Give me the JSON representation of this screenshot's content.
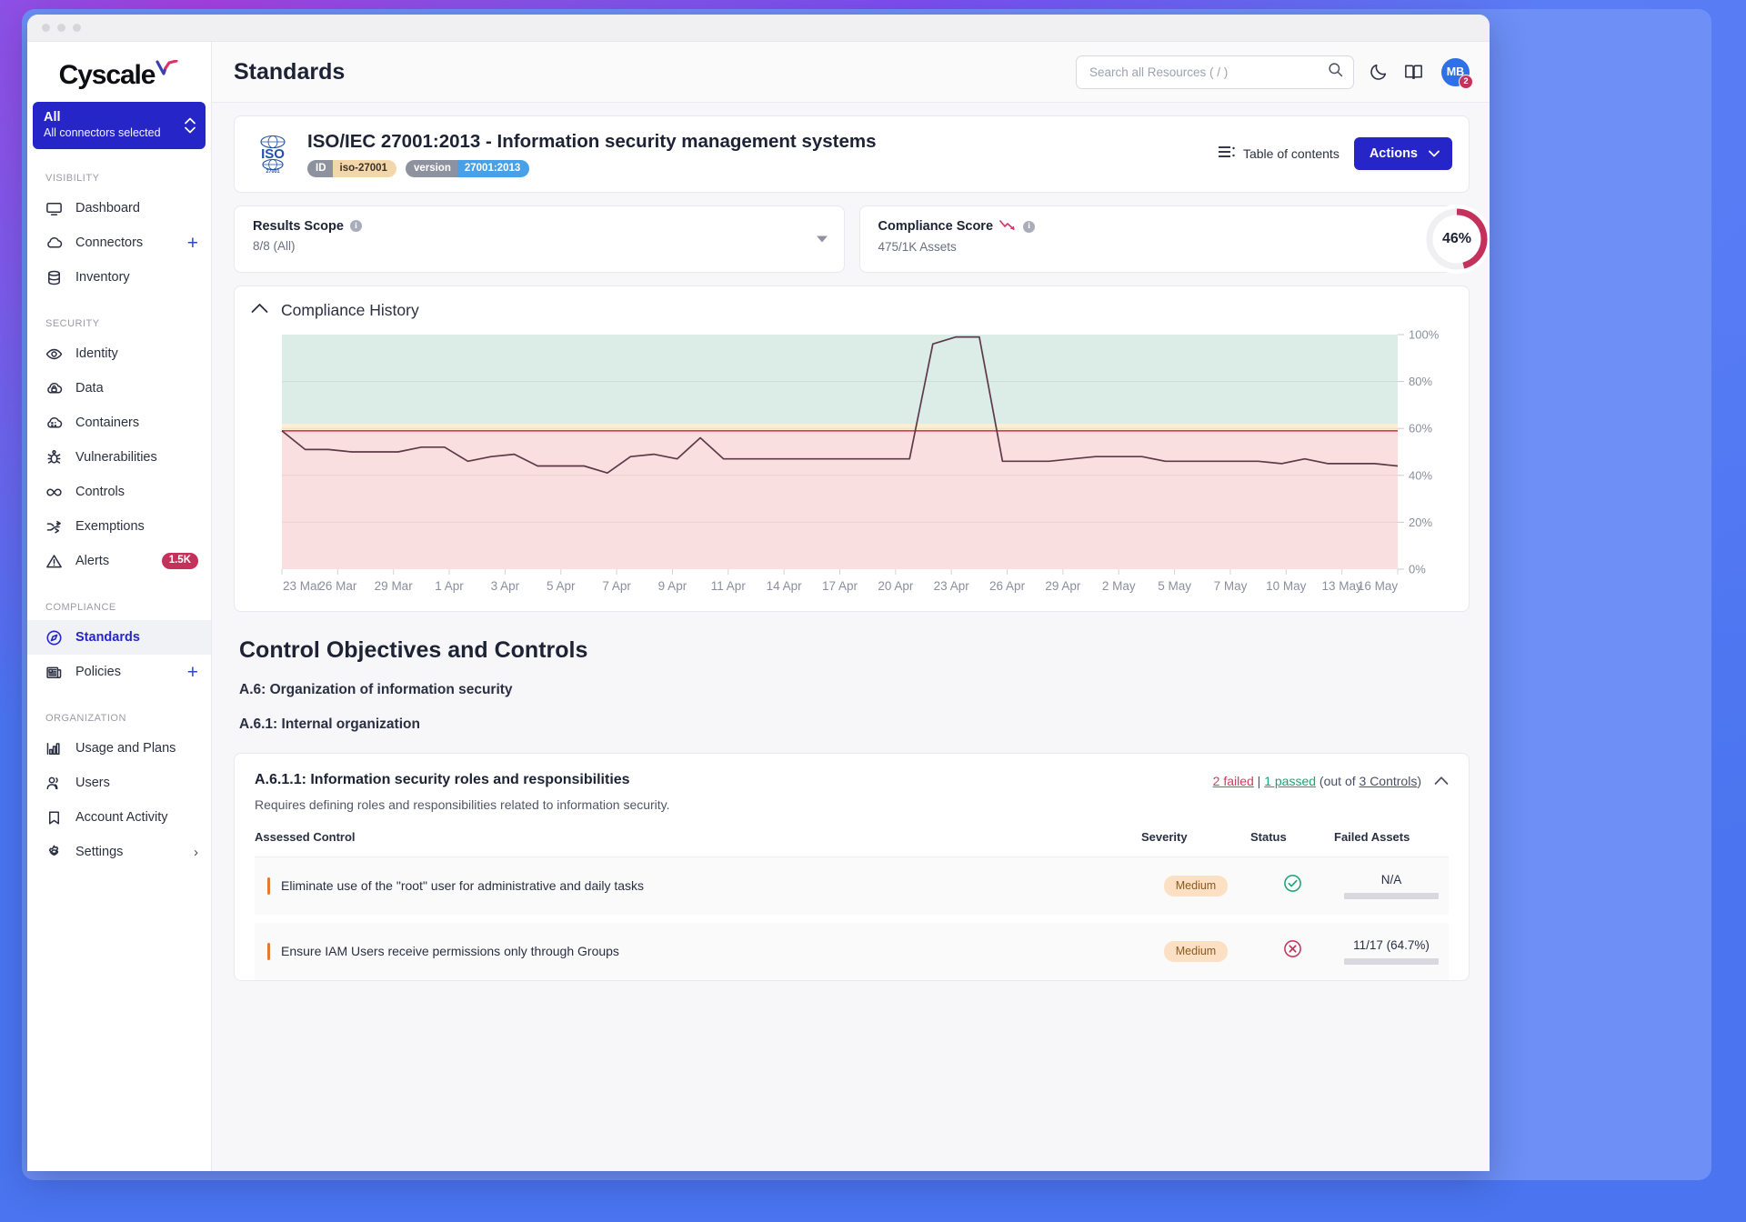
{
  "window": {
    "dots": 3
  },
  "brand": {
    "name": "Cyscale"
  },
  "connector_select": {
    "title": "All",
    "subtitle": "All connectors selected"
  },
  "sidebar": {
    "groups": [
      {
        "label": "VISIBILITY",
        "items": [
          {
            "label": "Dashboard",
            "icon": "monitor-icon",
            "active": false,
            "plus": false,
            "arrow": false
          },
          {
            "label": "Connectors",
            "icon": "cloud-icon",
            "active": false,
            "plus": true,
            "arrow": false
          },
          {
            "label": "Inventory",
            "icon": "database-icon",
            "active": false,
            "plus": false,
            "arrow": false
          }
        ]
      },
      {
        "label": "SECURITY",
        "items": [
          {
            "label": "Identity",
            "icon": "eye-icon",
            "active": false,
            "plus": false,
            "arrow": false
          },
          {
            "label": "Data",
            "icon": "cloud-lock-icon",
            "active": false,
            "plus": false,
            "arrow": false
          },
          {
            "label": "Containers",
            "icon": "container-icon",
            "active": false,
            "plus": false,
            "arrow": false
          },
          {
            "label": "Vulnerabilities",
            "icon": "bug-icon",
            "active": false,
            "plus": false,
            "arrow": false
          },
          {
            "label": "Controls",
            "icon": "infinity-icon",
            "active": false,
            "plus": false,
            "arrow": false
          },
          {
            "label": "Exemptions",
            "icon": "shuffle-icon",
            "active": false,
            "plus": false,
            "arrow": false
          },
          {
            "label": "Alerts",
            "icon": "warning-icon",
            "active": false,
            "plus": false,
            "arrow": false,
            "badge": "1.5K"
          }
        ]
      },
      {
        "label": "COMPLIANCE",
        "items": [
          {
            "label": "Standards",
            "icon": "compass-icon",
            "active": true,
            "plus": false,
            "arrow": false
          },
          {
            "label": "Policies",
            "icon": "newspaper-icon",
            "active": false,
            "plus": true,
            "arrow": false
          }
        ]
      },
      {
        "label": "ORGANIZATION",
        "items": [
          {
            "label": "Usage and Plans",
            "icon": "bar-chart-icon",
            "active": false,
            "plus": false,
            "arrow": false
          },
          {
            "label": "Users",
            "icon": "users-icon",
            "active": false,
            "plus": false,
            "arrow": false
          },
          {
            "label": "Account Activity",
            "icon": "bookmark-icon",
            "active": false,
            "plus": false,
            "arrow": false
          },
          {
            "label": "Settings",
            "icon": "gear-icon",
            "active": false,
            "plus": false,
            "arrow": true
          }
        ]
      }
    ]
  },
  "topbar": {
    "title": "Standards",
    "search_placeholder": "Search all Resources ( / )",
    "search_value": "",
    "icons": [
      "search-icon",
      "moon-icon",
      "book-icon"
    ],
    "avatar_initials": "MB",
    "avatar_count": "2"
  },
  "standard": {
    "logo_text": "ISO",
    "logo_sub": "27001",
    "title": "ISO/IEC 27001:2013 - Information security management systems",
    "tags": [
      {
        "key": "ID",
        "value": "iso-27001"
      },
      {
        "key": "version",
        "value": "27001:2013"
      }
    ],
    "toc_label": "Table of contents",
    "actions_label": "Actions"
  },
  "stats": {
    "results_scope": {
      "title": "Results Scope",
      "value": "8/8 (All)"
    },
    "compliance_score": {
      "title": "Compliance Score",
      "value": "475/1K Assets",
      "percent": "46%",
      "percent_number": 46,
      "trend": "down",
      "accent": "#c4325c"
    }
  },
  "history": {
    "title": "Compliance History",
    "expanded": true
  },
  "chart_data": {
    "type": "line",
    "title": "Compliance History",
    "xlabel": "",
    "ylabel": "",
    "ylim": [
      0,
      100
    ],
    "yticks": [
      "0%",
      "20%",
      "40%",
      "60%",
      "80%",
      "100%"
    ],
    "grid": true,
    "legend": false,
    "line_color": "#5d3a4a",
    "bands": [
      {
        "name": "fail",
        "from": 0,
        "to": 59,
        "color": "#fadfe1"
      },
      {
        "name": "warning",
        "from": 59,
        "to": 62,
        "color": "#fbeed2"
      },
      {
        "name": "pass",
        "from": 62,
        "to": 100,
        "color": "#dcece6"
      }
    ],
    "threshold": {
      "value": 59,
      "color": "#e0364f"
    },
    "x": [
      "23 Mar",
      "26 Mar",
      "29 Mar",
      "1 Apr",
      "3 Apr",
      "5 Apr",
      "7 Apr",
      "9 Apr",
      "11 Apr",
      "14 Apr",
      "17 Apr",
      "20 Apr",
      "23 Apr",
      "26 Apr",
      "29 Apr",
      "2 May",
      "5 May",
      "7 May",
      "10 May",
      "13 May",
      "16 May"
    ],
    "tick_labels": [
      "23 Mar",
      "26 Mar",
      "29 Mar",
      "1 Apr",
      "3 Apr",
      "5 Apr",
      "7 Apr",
      "9 Apr",
      "11 Apr",
      "14 Apr",
      "17 Apr",
      "20 Apr",
      "23 Apr",
      "26 Apr",
      "29 Apr",
      "2 May",
      "5 May",
      "7 May",
      "10 May",
      "13 May",
      "16 May"
    ],
    "series": [
      {
        "name": "Compliance Score",
        "values": [
          59,
          51,
          51,
          50,
          50,
          50,
          52,
          52,
          46,
          48,
          49,
          44,
          44,
          44,
          41,
          48,
          49,
          47,
          56,
          47,
          47,
          47,
          47,
          47,
          47,
          47,
          47,
          47,
          96,
          99,
          99,
          46,
          46,
          46,
          47,
          48,
          48,
          48,
          46,
          46,
          46,
          46,
          46,
          45,
          47,
          45,
          45,
          45,
          44
        ]
      }
    ]
  },
  "controls_section": {
    "heading": "Control Objectives and Controls",
    "objective": "A.6: Organization of information security",
    "sub_objective": "A.6.1: Internal organization"
  },
  "control_card": {
    "name": "A.6.1.1: Information security roles and responsibilities",
    "description": "Requires defining roles and responsibilities related to information security.",
    "failed_label": "2 failed",
    "separator": " | ",
    "passed_label": "1 passed",
    "outof_prefix": " (out of ",
    "total_label": "3 Controls",
    "outof_suffix": ")",
    "columns": {
      "assessed": "Assessed Control",
      "severity": "Severity",
      "status": "Status",
      "failed_assets": "Failed Assets"
    },
    "rows": [
      {
        "name": "Eliminate use of the \"root\" user for administrative and daily tasks",
        "severity": "Medium",
        "status": "passed",
        "failed_assets": "N/A",
        "progress": 0
      },
      {
        "name": "Ensure IAM Users receive permissions only through Groups",
        "severity": "Medium",
        "status": "failed",
        "failed_assets": "11/17 (64.7%)",
        "progress": 64.7
      }
    ]
  }
}
